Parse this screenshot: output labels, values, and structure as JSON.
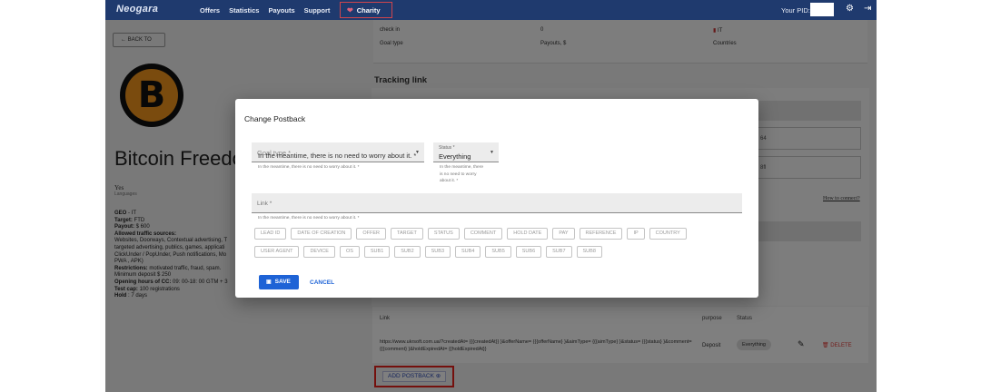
{
  "nav": {
    "logo": "Neogara",
    "items": [
      "Offers",
      "Statistics",
      "Payouts",
      "Support"
    ],
    "charity": "Charity",
    "pid_label": "Your PID:"
  },
  "left": {
    "back": "← BACK TO",
    "btc_symbol": "B",
    "title": "Bitcoin Freedo",
    "languages_value": "Yes",
    "languages_label": "Languages",
    "details": [
      {
        "label": "GEO",
        "text": " - IT"
      },
      {
        "label": "Target:",
        "text": " FTD"
      },
      {
        "label": "Payout:",
        "text": " $ 600"
      },
      {
        "label": "Allowed traffic sources:",
        "text": ""
      },
      {
        "label": "",
        "text": "Websites, Doorways, Contextual advertising, T"
      },
      {
        "label": "",
        "text": "targeted advertising, publics, games, applicati"
      },
      {
        "label": "",
        "text": "ClickUnder / PopUnder, Push notifications, Mo"
      },
      {
        "label": "",
        "text": "PWA , APK)"
      },
      {
        "label": "Restrictions:",
        "text": " motivated traffic, fraud, spam."
      },
      {
        "label": "",
        "text": "Minimum deposit $ 250"
      },
      {
        "label": "Opening hours of CC:",
        "text": " 09: 00-18: 00 GTM + 3"
      },
      {
        "label": "Test cap:",
        "text": " 100 registrations"
      },
      {
        "label": "Hold",
        "text": " : 7 days"
      }
    ]
  },
  "right": {
    "row1": {
      "label": "check in",
      "value": "0",
      "geo": "IT"
    },
    "row2": {
      "label": "Goal type",
      "value": "Payouts, $",
      "geo": "Countries"
    },
    "tracking_title": "Tracking link",
    "field2_text": "64",
    "field3_text": "8fl",
    "how_to_connect": "How to connect?",
    "postbacks": {
      "headers": {
        "link": "Link",
        "purpose": "purpose",
        "status": "Status"
      },
      "row": {
        "link": "https://www.ukrsoft.com.ua/?createdAt= {{{createdAt}} }&offerName= {{{offerName} }&aimType= {{{aimType} }&status= {{{status} }&comment= {{{comment} }&holdExpiredAt= {{holdExpiredAt}}",
        "purpose": "Deposit",
        "status": "Everything",
        "delete": "DELETE"
      }
    },
    "add_postback": "ADD POSTBACK"
  },
  "modal": {
    "title": "Change Postback",
    "goal_type_label": "Goal type *",
    "goal_type_value": "In the meantime, there is no need to worry about it. *",
    "goal_type_helper": "In the meantime, there is no need to worry about it. *",
    "status_label": "Status *",
    "status_value": "Everything",
    "status_helper": [
      "In the meantime, there",
      "is no need to worry",
      "about it. *"
    ],
    "link_label": "Link *",
    "link_helper": "In the meantime, there is no need to worry about it. *",
    "chips_row1": [
      "LEAD ID",
      "DATE OF CREATION",
      "OFFER",
      "TARGET",
      "STATUS",
      "COMMENT",
      "HOLD DATE",
      "PAY",
      "REFERENCE",
      "IP",
      "COUNTRY"
    ],
    "chips_row2": [
      "USER AGENT",
      "DEVICE",
      "OS",
      "SUB1",
      "SUB2",
      "SUB3",
      "SUB4",
      "SUB5",
      "SUB6",
      "SUB7",
      "SUB8"
    ],
    "save": "SAVE",
    "cancel": "CANCEL"
  }
}
